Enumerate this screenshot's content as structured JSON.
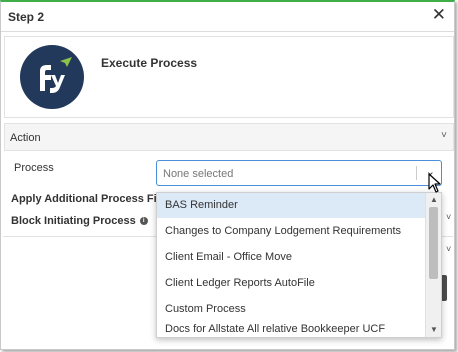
{
  "header": {
    "title": "Step 2",
    "close_glyph": "✕"
  },
  "process": {
    "title": "Execute Process",
    "logo_icon": "fym-logo"
  },
  "section": {
    "label": "Action",
    "chevron": "˅"
  },
  "fields": {
    "process_label": "Process",
    "filter_label": "Apply Additional Process Filter",
    "block_label": "Block  Initiating Process",
    "info_glyph": "i"
  },
  "select": {
    "placeholder": "None selected",
    "chevron": "⌄"
  },
  "dropdown": {
    "items": [
      "BAS Reminder",
      "Changes to Company Lodgement Requirements",
      "Client Email - Office Move",
      "Client Ledger Reports AutoFile",
      "Custom Process",
      "Docs for Allstate All relative Bookkeeper UCF"
    ],
    "selected_index": 0,
    "scroll_up": "▲",
    "scroll_down": "▼"
  },
  "background": {
    "chev_a": "˅",
    "chev_b": "˅"
  },
  "colors": {
    "accent_top": "#3fae49",
    "logo_bg": "#23395b",
    "select_border": "#4a90d9",
    "hover_bg": "#dce9f7"
  }
}
